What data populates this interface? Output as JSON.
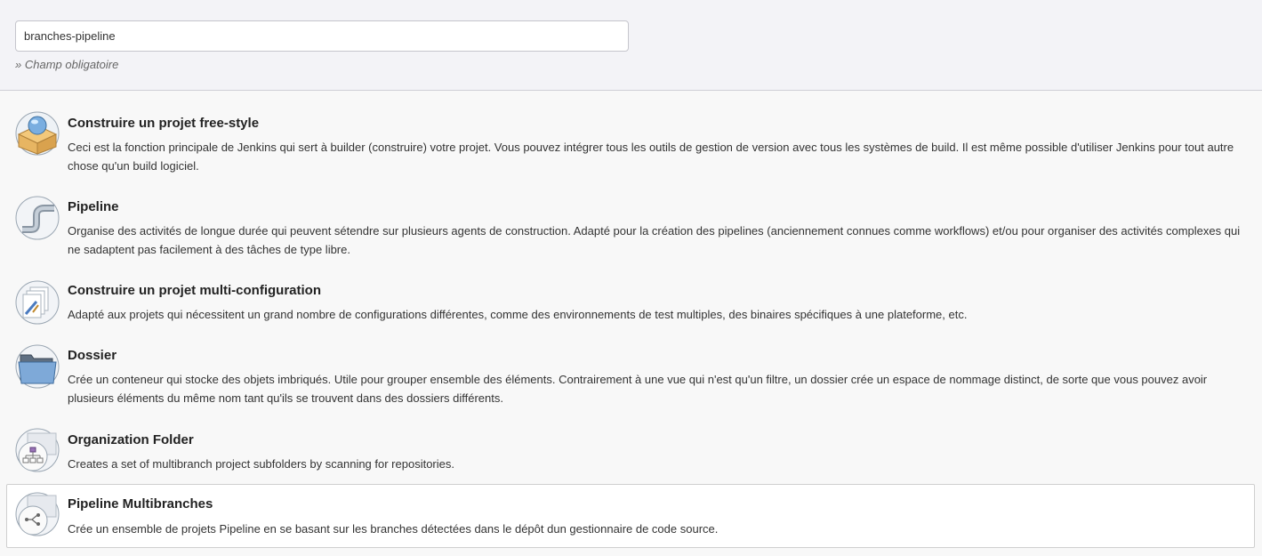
{
  "name_field": {
    "value": "branches-pipeline",
    "required_note": "» Champ obligatoire"
  },
  "items": [
    {
      "title": "Construire un projet free-style",
      "description": "Ceci est la fonction principale de Jenkins qui sert à builder (construire) votre projet. Vous pouvez intégrer tous les outils de gestion de version avec tous les systèmes de build. Il est même possible d'utiliser Jenkins pour tout autre chose qu'un build logiciel.",
      "icon": "freestyle-project-icon"
    },
    {
      "title": "Pipeline",
      "description": "Organise des activités de longue durée qui peuvent sétendre sur plusieurs agents de construction. Adapté pour la création des pipelines (anciennement connues comme workflows) et/ou pour organiser des activités complexes qui ne sadaptent pas facilement à des tâches de type libre.",
      "icon": "pipeline-icon"
    },
    {
      "title": "Construire un projet multi-configuration",
      "description": "Adapté aux projets qui nécessitent un grand nombre de configurations différentes, comme des environnements de test multiples, des binaires spécifiques à une plateforme, etc.",
      "icon": "multi-configuration-icon"
    },
    {
      "title": "Dossier",
      "description": "Crée un conteneur qui stocke des objets imbriqués. Utile pour grouper ensemble des éléments. Contrairement à une vue qui n'est qu'un filtre, un dossier crée un espace de nommage distinct, de sorte que vous pouvez avoir plusieurs éléments du même nom tant qu'ils se trouvent dans des dossiers différents.",
      "icon": "folder-icon"
    },
    {
      "title": "Organization Folder",
      "description": "Creates a set of multibranch project subfolders by scanning for repositories.",
      "icon": "organization-folder-icon"
    },
    {
      "title": "Pipeline Multibranches",
      "description": "Crée un ensemble de projets Pipeline en se basant sur les branches détectées dans le dépôt dun gestionnaire de code source.",
      "icon": "multibranch-pipeline-icon",
      "selected": true
    }
  ]
}
